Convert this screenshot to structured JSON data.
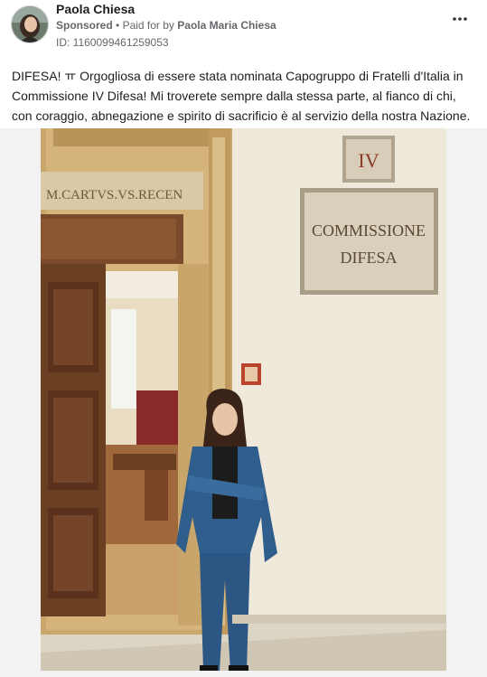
{
  "post": {
    "page_name": "Paola Chiesa",
    "sponsored_label": "Sponsored",
    "separator": "•",
    "paid_for_prefix": "Paid for by",
    "payer_name": "Paola Maria Chiesa",
    "ad_id": "ID: 1160099461259053",
    "more_icon": "more-horizontal-icon",
    "caption": "DIFESA! ㅠ Orgogliosa di essere stata nominata Capogruppo di Fratelli d'Italia in Commissione IV Difesa! Mi troverete sempre dalla stessa parte, al fianco di chi, con coraggio, abnegazione e spirito di sacrificio è al servizio della nostra Nazione."
  },
  "photo": {
    "plaque_small": "IV",
    "plaque_line1": "COMMISSIONE",
    "plaque_line2": "DIFESA",
    "inscription": "M.CARTVS.VS.RECEN"
  },
  "colors": {
    "meta_gray": "#65676b",
    "wall": "#ece6d8",
    "suit_blue": "#2f5e8c",
    "door_frame": "#c7a46a",
    "wood_door": "#6b3f22"
  }
}
